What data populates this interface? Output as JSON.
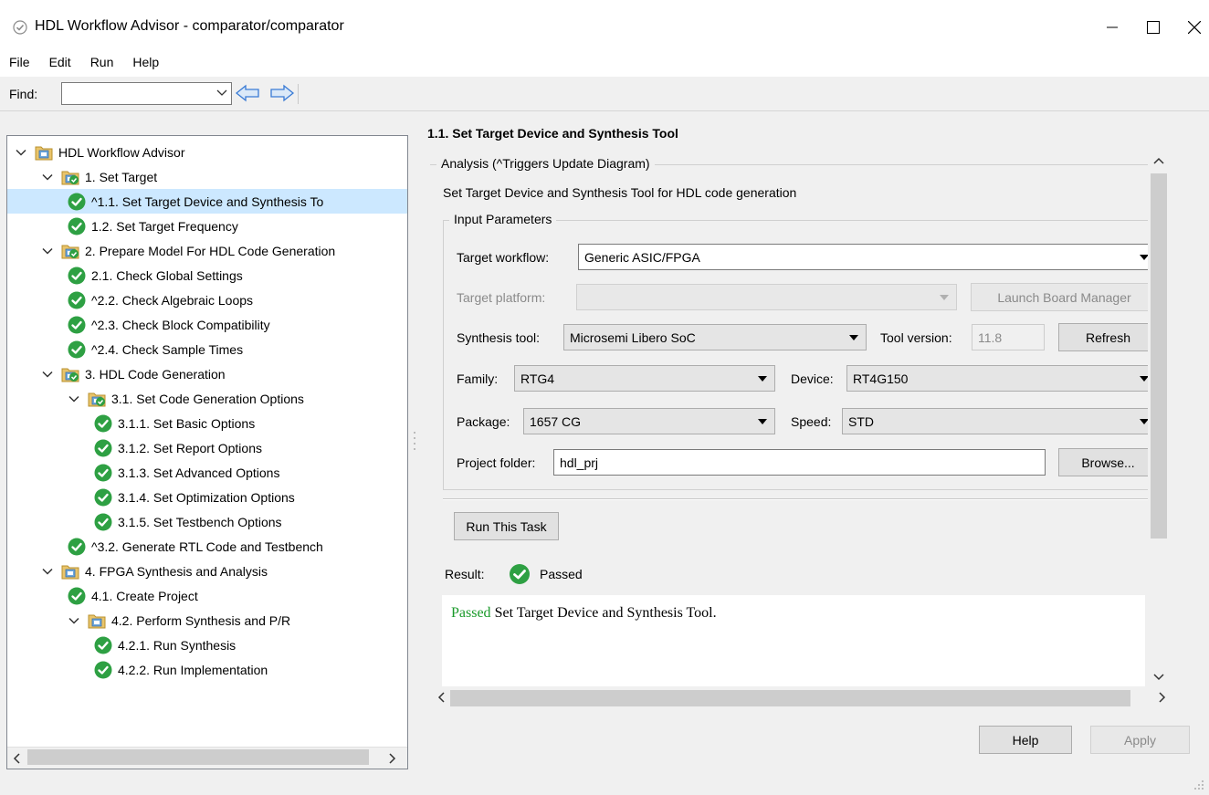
{
  "window": {
    "title": "HDL Workflow Advisor - comparator/comparator"
  },
  "menu": [
    "File",
    "Edit",
    "Run",
    "Help"
  ],
  "find": {
    "label": "Find:",
    "value": ""
  },
  "tree": [
    {
      "label": "HDL Workflow Advisor",
      "icon": "advisor-folder-icon",
      "expanded": true,
      "selected": false,
      "has_check": false
    },
    {
      "label": "1. Set Target",
      "icon": "task-folder-check-icon",
      "expanded": true,
      "selected": false,
      "has_check": false
    },
    {
      "label": "^1.1. Set Target Device and Synthesis To",
      "icon": "passed-check-icon",
      "expanded": null,
      "selected": true,
      "has_check": true
    },
    {
      "label": "1.2. Set Target Frequency",
      "icon": "passed-check-icon",
      "expanded": null,
      "selected": false,
      "has_check": true
    },
    {
      "label": "2. Prepare Model For HDL Code Generation",
      "icon": "task-folder-check-icon",
      "expanded": true,
      "selected": false,
      "has_check": false
    },
    {
      "label": "2.1. Check Global Settings",
      "icon": "passed-check-icon",
      "expanded": null,
      "selected": false,
      "has_check": true
    },
    {
      "label": "^2.2. Check Algebraic Loops",
      "icon": "passed-check-icon",
      "expanded": null,
      "selected": false,
      "has_check": true
    },
    {
      "label": "^2.3. Check Block Compatibility",
      "icon": "passed-check-icon",
      "expanded": null,
      "selected": false,
      "has_check": true
    },
    {
      "label": "^2.4. Check Sample Times",
      "icon": "passed-check-icon",
      "expanded": null,
      "selected": false,
      "has_check": true
    },
    {
      "label": "3. HDL Code Generation",
      "icon": "task-folder-check-icon",
      "expanded": true,
      "selected": false,
      "has_check": false
    },
    {
      "label": "3.1. Set Code Generation Options",
      "icon": "task-folder-check-icon",
      "expanded": true,
      "selected": false,
      "has_check": false
    },
    {
      "label": "3.1.1. Set Basic Options",
      "icon": "passed-check-icon",
      "expanded": null,
      "selected": false,
      "has_check": true
    },
    {
      "label": "3.1.2. Set Report Options",
      "icon": "passed-check-icon",
      "expanded": null,
      "selected": false,
      "has_check": true
    },
    {
      "label": "3.1.3. Set Advanced Options",
      "icon": "passed-check-icon",
      "expanded": null,
      "selected": false,
      "has_check": true
    },
    {
      "label": "3.1.4. Set Optimization Options",
      "icon": "passed-check-icon",
      "expanded": null,
      "selected": false,
      "has_check": true
    },
    {
      "label": "3.1.5. Set Testbench Options",
      "icon": "passed-check-icon",
      "expanded": null,
      "selected": false,
      "has_check": true
    },
    {
      "label": "^3.2. Generate RTL Code and Testbench",
      "icon": "passed-check-icon",
      "expanded": null,
      "selected": false,
      "has_check": true
    },
    {
      "label": "4. FPGA Synthesis and Analysis",
      "icon": "advisor-folder-icon",
      "expanded": true,
      "selected": false,
      "has_check": false
    },
    {
      "label": "4.1. Create Project",
      "icon": "passed-check-icon",
      "expanded": null,
      "selected": false,
      "has_check": true
    },
    {
      "label": "4.2. Perform Synthesis and P/R",
      "icon": "advisor-folder-icon",
      "expanded": true,
      "selected": false,
      "has_check": false
    },
    {
      "label": "4.2.1. Run Synthesis",
      "icon": "passed-check-icon",
      "expanded": null,
      "selected": false,
      "has_check": true
    },
    {
      "label": "4.2.2. Run Implementation",
      "icon": "passed-check-icon",
      "expanded": null,
      "selected": false,
      "has_check": true
    }
  ],
  "task": {
    "title": "1.1. Set Target Device and Synthesis Tool",
    "analysis_legend": "Analysis (^Triggers Update Diagram)",
    "description": "Set Target Device and Synthesis Tool for HDL code generation",
    "input_params_legend": "Input Parameters",
    "target_workflow_label": "Target workflow:",
    "target_workflow_value": "Generic ASIC/FPGA",
    "target_platform_label": "Target platform:",
    "target_platform_value": "",
    "launch_board_manager": "Launch Board Manager",
    "synthesis_tool_label": "Synthesis tool:",
    "synthesis_tool_value": "Microsemi Libero SoC",
    "tool_version_label": "Tool version:",
    "tool_version_value": "11.8",
    "refresh": "Refresh",
    "family_label": "Family:",
    "family_value": "RTG4",
    "device_label": "Device:",
    "device_value": "RT4G150",
    "package_label": "Package:",
    "package_value": "1657 CG",
    "speed_label": "Speed:",
    "speed_value": "STD",
    "project_folder_label": "Project folder:",
    "project_folder_value": "hdl_prj",
    "browse": "Browse...",
    "run_task": "Run This Task",
    "result_label": "Result:",
    "result_status": "Passed",
    "result_msg_status": "Passed",
    "result_msg_text": " Set Target Device and Synthesis Tool."
  },
  "footer": {
    "help": "Help",
    "apply": "Apply"
  },
  "colors": {
    "check_green": "#2ea043",
    "selected_row": "#cce8ff",
    "passed_text": "#1a9a2a"
  }
}
